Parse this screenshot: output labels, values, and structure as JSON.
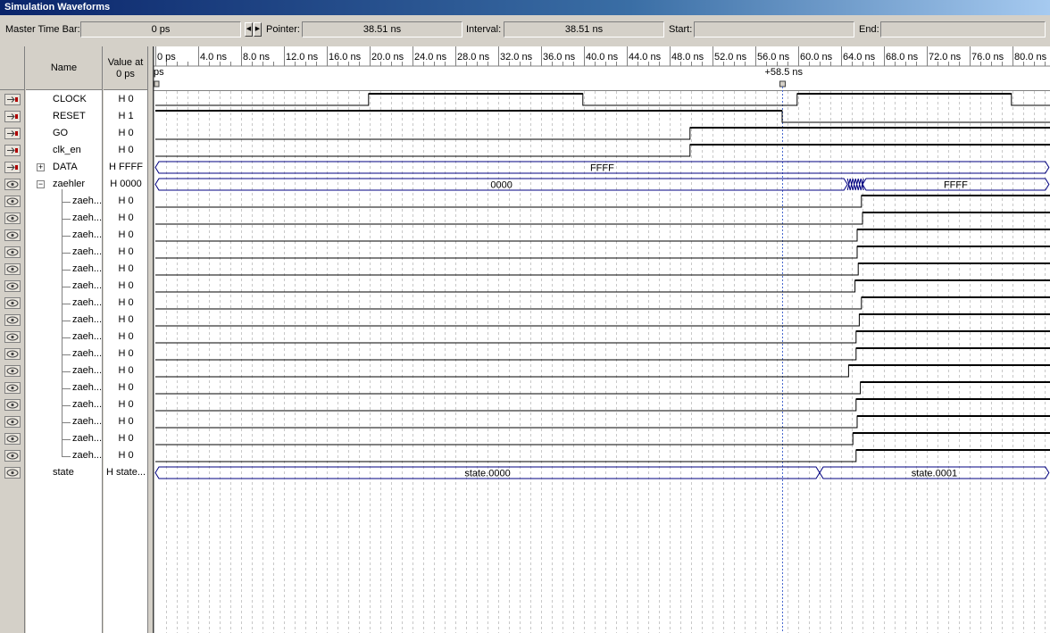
{
  "window": {
    "title": "Simulation Waveforms"
  },
  "toolbar": {
    "master_label": "Master Time Bar:",
    "master_value": "0 ps",
    "pointer_label": "Pointer:",
    "pointer_value": "38.51 ns",
    "interval_label": "Interval:",
    "interval_value": "38.51 ns",
    "start_label": "Start:",
    "start_value": "",
    "end_label": "End:",
    "end_value": ""
  },
  "columns": {
    "name": "Name",
    "value": "Value at\n0 ps"
  },
  "timescale": {
    "ticks": [
      "0 ps",
      "4.0 ns",
      "8.0 ns",
      "12.0 ns",
      "16.0 ns",
      "20.0 ns",
      "24.0 ns",
      "28.0 ns",
      "32.0 ns",
      "36.0 ns",
      "40.0 ns",
      "44.0 ns",
      "48.0 ns",
      "52.0 ns",
      "56.0 ns",
      "60.0 ns",
      "64.0 ns",
      "68.0 ns",
      "72.0 ns",
      "76.0 ns",
      "80.0 ns"
    ],
    "origin_label": "ps",
    "cursor_label": "+58.5 ns",
    "cursor_ns": 58.5,
    "max_ns": 83.4
  },
  "signals": [
    {
      "name": "CLOCK",
      "value": "H 0",
      "icon": "input-pin-icon",
      "type": "bit",
      "init": 0,
      "edges": [
        [
          19.9,
          1
        ],
        [
          39.9,
          0
        ],
        [
          59.9,
          1
        ],
        [
          79.9,
          0
        ]
      ]
    },
    {
      "name": "RESET",
      "value": "H 1",
      "icon": "input-pin-icon",
      "type": "bit",
      "init": 1,
      "edges": [
        [
          58.5,
          0
        ]
      ]
    },
    {
      "name": "GO",
      "value": "H 0",
      "icon": "input-pin-icon",
      "type": "bit",
      "init": 0,
      "edges": [
        [
          49.9,
          1
        ]
      ]
    },
    {
      "name": "clk_en",
      "value": "H 0",
      "icon": "input-pin-icon",
      "type": "bit",
      "init": 0,
      "edges": [
        [
          49.9,
          1
        ]
      ]
    },
    {
      "name": "DATA",
      "value": "H FFFF",
      "icon": "input-bus-icon",
      "type": "bus",
      "expander": "+",
      "segments": [
        [
          "FFFF",
          0,
          83.4
        ]
      ]
    },
    {
      "name": "zaehler",
      "value": "H 0000",
      "icon": "output-pin-icon",
      "type": "bus",
      "expander": "-",
      "segments": [
        [
          "0000",
          0,
          64.6
        ],
        [
          "FFFF",
          66.0,
          83.4
        ]
      ],
      "glitch": [
        64.6,
        66.0
      ]
    },
    {
      "name": "zaeh...",
      "value": "H 0",
      "icon": "output-pin-icon",
      "type": "bit",
      "child": true,
      "init": 0,
      "edges": [
        [
          65.9,
          1
        ]
      ]
    },
    {
      "name": "zaeh...",
      "value": "H 0",
      "icon": "output-pin-icon",
      "type": "bit",
      "child": true,
      "init": 0,
      "edges": [
        [
          66.0,
          1
        ]
      ]
    },
    {
      "name": "zaeh...",
      "value": "H 0",
      "icon": "output-pin-icon",
      "type": "bit",
      "child": true,
      "init": 0,
      "edges": [
        [
          65.5,
          1
        ]
      ]
    },
    {
      "name": "zaeh...",
      "value": "H 0",
      "icon": "output-pin-icon",
      "type": "bit",
      "child": true,
      "init": 0,
      "edges": [
        [
          65.5,
          1
        ]
      ]
    },
    {
      "name": "zaeh...",
      "value": "H 0",
      "icon": "output-pin-icon",
      "type": "bit",
      "child": true,
      "init": 0,
      "edges": [
        [
          65.6,
          1
        ]
      ]
    },
    {
      "name": "zaeh...",
      "value": "H 0",
      "icon": "output-pin-icon",
      "type": "bit",
      "child": true,
      "init": 0,
      "edges": [
        [
          65.3,
          1
        ]
      ]
    },
    {
      "name": "zaeh...",
      "value": "H 0",
      "icon": "output-pin-icon",
      "type": "bit",
      "child": true,
      "init": 0,
      "edges": [
        [
          65.9,
          1
        ]
      ]
    },
    {
      "name": "zaeh...",
      "value": "H 0",
      "icon": "output-pin-icon",
      "type": "bit",
      "child": true,
      "init": 0,
      "edges": [
        [
          65.7,
          1
        ]
      ]
    },
    {
      "name": "zaeh...",
      "value": "H 0",
      "icon": "output-pin-icon",
      "type": "bit",
      "child": true,
      "init": 0,
      "edges": [
        [
          65.4,
          1
        ]
      ]
    },
    {
      "name": "zaeh...",
      "value": "H 0",
      "icon": "output-pin-icon",
      "type": "bit",
      "child": true,
      "init": 0,
      "edges": [
        [
          65.4,
          1
        ]
      ]
    },
    {
      "name": "zaeh...",
      "value": "H 0",
      "icon": "output-pin-icon",
      "type": "bit",
      "child": true,
      "init": 0,
      "edges": [
        [
          64.7,
          1
        ]
      ]
    },
    {
      "name": "zaeh...",
      "value": "H 0",
      "icon": "output-pin-icon",
      "type": "bit",
      "child": true,
      "init": 0,
      "edges": [
        [
          65.8,
          1
        ]
      ]
    },
    {
      "name": "zaeh...",
      "value": "H 0",
      "icon": "output-pin-icon",
      "type": "bit",
      "child": true,
      "init": 0,
      "edges": [
        [
          65.4,
          1
        ]
      ]
    },
    {
      "name": "zaeh...",
      "value": "H 0",
      "icon": "output-pin-icon",
      "type": "bit",
      "child": true,
      "init": 0,
      "edges": [
        [
          65.5,
          1
        ]
      ]
    },
    {
      "name": "zaeh...",
      "value": "H 0",
      "icon": "output-pin-icon",
      "type": "bit",
      "child": true,
      "init": 0,
      "edges": [
        [
          65.1,
          1
        ]
      ]
    },
    {
      "name": "zaeh...",
      "value": "H 0",
      "icon": "output-pin-icon",
      "type": "bit",
      "child": true,
      "init": 0,
      "edges": [
        [
          65.4,
          1
        ]
      ]
    },
    {
      "name": "state",
      "value": "H state...",
      "icon": "output-pin-icon",
      "type": "bus",
      "segments": [
        [
          "state.0000",
          0,
          62.0
        ],
        [
          "state.0001",
          62.0,
          83.4
        ]
      ]
    }
  ],
  "colors": {
    "bus_line": "#000080",
    "grid": "#c8c8c8",
    "cursor": "#4a6ad0",
    "wave": "#000000"
  }
}
